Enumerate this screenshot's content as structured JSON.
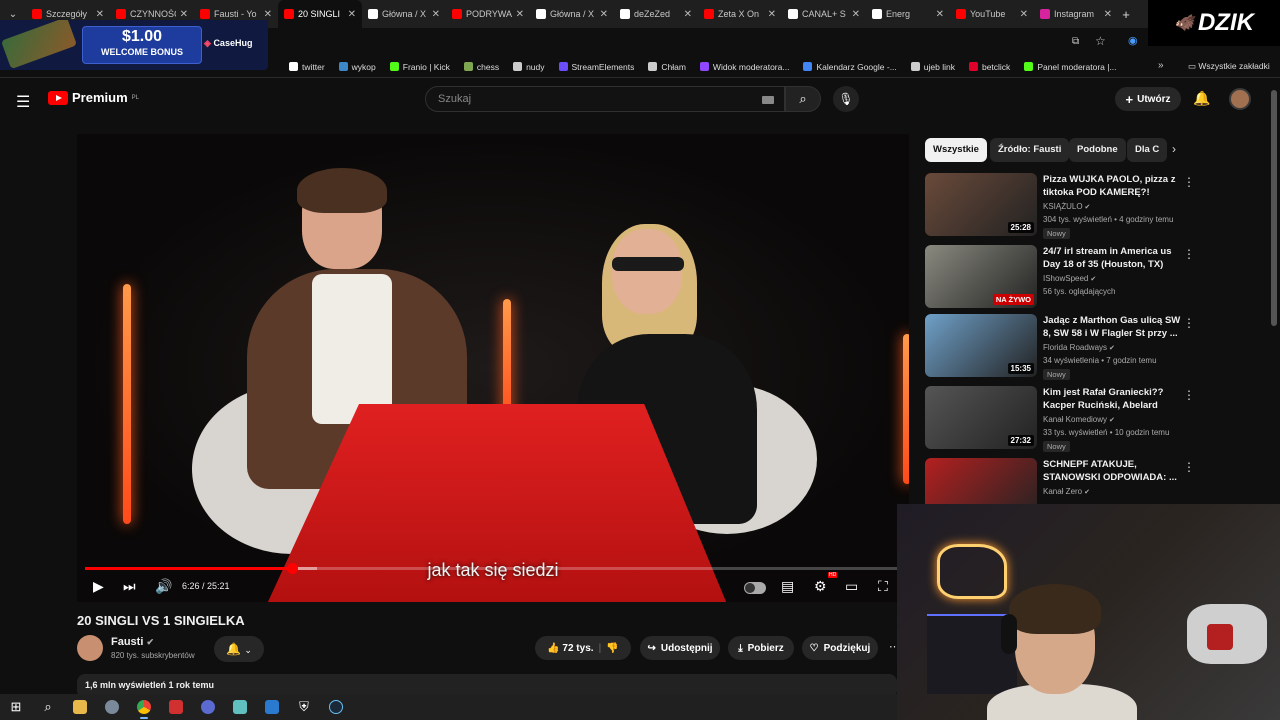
{
  "browser": {
    "tabs": [
      {
        "label": "Szczegóły",
        "icon": "youtube-icon",
        "color": "#ff0000"
      },
      {
        "label": "CZYNNOŚCI",
        "icon": "youtube-icon",
        "color": "#ff0000"
      },
      {
        "label": "Fausti - Yo",
        "icon": "youtube-icon",
        "color": "#ff0000"
      },
      {
        "label": "20 SINGLI",
        "icon": "youtube-icon",
        "color": "#ff0000",
        "active": true
      },
      {
        "label": "Główna / X",
        "icon": "x-icon",
        "color": "#ffffff"
      },
      {
        "label": "PODRYWA",
        "icon": "youtube-icon",
        "color": "#ff0000"
      },
      {
        "label": "Główna / X",
        "icon": "x-icon",
        "color": "#ffffff"
      },
      {
        "label": "deZeZed",
        "icon": "x-icon",
        "color": "#ffffff"
      },
      {
        "label": "Zeta X On",
        "icon": "youtube-icon",
        "color": "#ff0000"
      },
      {
        "label": "CANAL+ S",
        "icon": "x-icon",
        "color": "#ffffff"
      },
      {
        "label": "Energ",
        "icon": "tiktok-icon",
        "color": "#ffffff"
      },
      {
        "label": "YouTube",
        "icon": "youtube-icon",
        "color": "#ff0000"
      },
      {
        "label": "Instagram",
        "icon": "instagram-icon",
        "color": "#d6249f"
      }
    ],
    "bookmarks": [
      {
        "label": "twitter",
        "icon": "x-icon",
        "color": "#ffffff"
      },
      {
        "label": "wykop",
        "icon": "wykop-icon",
        "color": "#3d86c7"
      },
      {
        "label": "Franio | Kick",
        "icon": "kick-icon",
        "color": "#53fc18"
      },
      {
        "label": "chess",
        "icon": "chess-icon",
        "color": "#7fa650"
      },
      {
        "label": "nudy",
        "icon": "folder-icon",
        "color": "#cccccc"
      },
      {
        "label": "StreamElements",
        "icon": "streamelements-icon",
        "color": "#6b4cff"
      },
      {
        "label": "Chłam",
        "icon": "globe-icon",
        "color": "#cccccc"
      },
      {
        "label": "Widok moderatora...",
        "icon": "twitch-icon",
        "color": "#9146ff"
      },
      {
        "label": "Kalendarz Google -...",
        "icon": "calendar-icon",
        "color": "#4285f4"
      },
      {
        "label": "ujeb link",
        "icon": "globe-icon",
        "color": "#cccccc"
      },
      {
        "label": "betclick",
        "icon": "betclick-icon",
        "color": "#e2002a"
      },
      {
        "label": "Panel moderatora |...",
        "icon": "kick-icon",
        "color": "#53fc18"
      }
    ],
    "all_bookmarks": "Wszystkie zakładki"
  },
  "ad": {
    "amount": "$1.00",
    "text": "WELCOME BONUS",
    "brand": "CaseHug"
  },
  "overlay_logo": "DZIK",
  "youtube": {
    "logo": "Premium",
    "logo_region": "PL",
    "search_placeholder": "Szukaj",
    "create_label": "Utwórz",
    "accent": "#ff0000"
  },
  "video": {
    "subtitle": "jak tak się siedzi",
    "time": "6:26 / 25:21",
    "progress": 0.254,
    "title": "20 SINGLI VS 1 SINGIELKA",
    "channel": "Fausti",
    "subscribers": "820 tys. subskrybentów",
    "likes": "72 tys.",
    "share_label": "Udostępnij",
    "download_label": "Pobierz",
    "thanks_label": "Podziękuj",
    "views_meta": "1,6 mln wyświetleń  1 rok temu"
  },
  "chips": [
    {
      "label": "Wszystkie",
      "active": true
    },
    {
      "label": "Źródło: Fausti"
    },
    {
      "label": "Podobne"
    },
    {
      "label": "Dla C"
    }
  ],
  "recommendations": [
    {
      "title": "Pizza WUJKA PAOLO, pizza z tiktoka POD KAMERĘ?!",
      "channel": "KSIĄŻULO",
      "stats": "304 tys. wyświetleń • 4 godziny temu",
      "badge": "Nowy",
      "duration": "25:28",
      "thumb_color": "#6a4a3a"
    },
    {
      "title": "24/7 irl stream in America us Day 18 of 35 (Houston, TX)",
      "channel": "IShowSpeed",
      "stats": "56 tys. oglądających",
      "badge": "",
      "duration": "NA ŻYWO",
      "live": true,
      "thumb_color": "#8a8a80"
    },
    {
      "title": "Jadąc z Marthon Gas ulicą SW 8, SW 58 i W Flagler St przy ...",
      "channel": "Florida Roadways",
      "stats": "34 wyświetlenia • 7 godzin temu",
      "badge": "Nowy",
      "duration": "15:35",
      "thumb_color": "#6fa0c8"
    },
    {
      "title": "Kim jest Rafał Graniecki?? Kacper Ruciński, Abelard Giza,...",
      "channel": "Kanał Komediowy",
      "stats": "33 tys. wyświetleń • 10 godzin temu",
      "badge": "Nowy",
      "duration": "27:32",
      "thumb_color": "#555555"
    },
    {
      "title": "SCHNEPF ATAKUJE, STANOWSKI ODPOWIADA: ...",
      "channel": "Kanał Zero",
      "stats": "",
      "badge": "",
      "duration": "",
      "thumb_color": "#b42020"
    }
  ]
}
